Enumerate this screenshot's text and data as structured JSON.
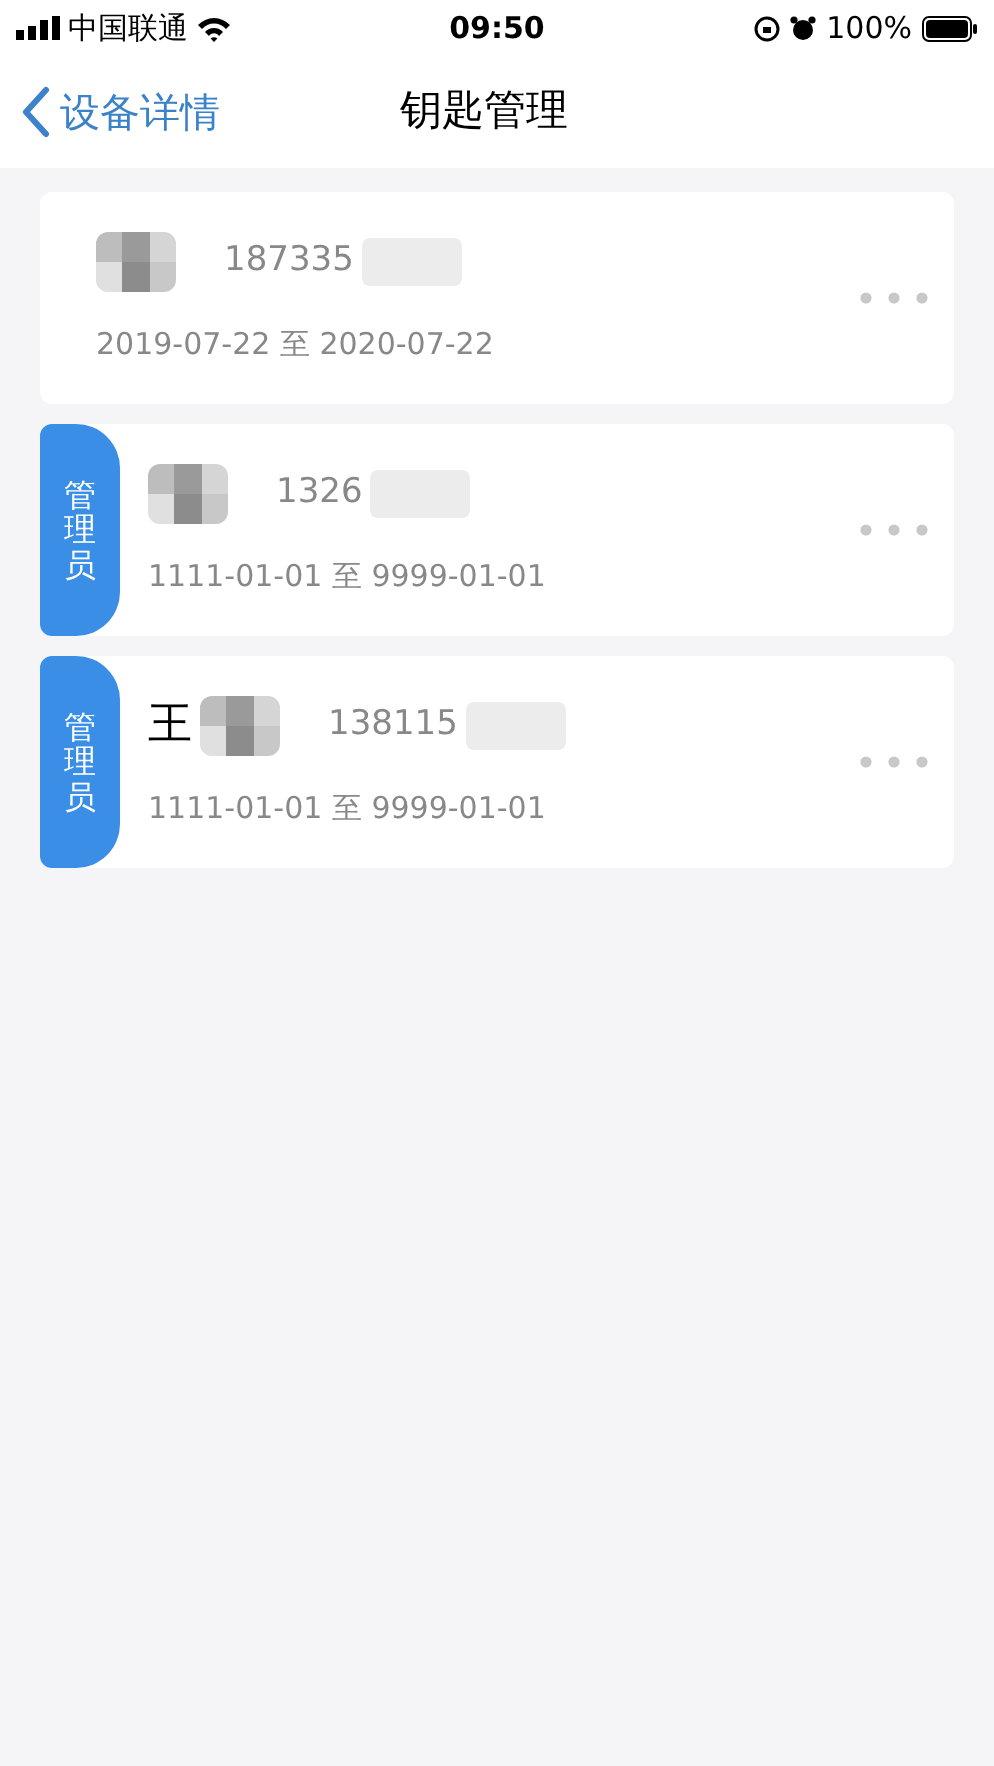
{
  "status_bar": {
    "carrier": "中国联通",
    "time": "09:50",
    "battery": "100%"
  },
  "nav": {
    "back": "设备详情",
    "title": "钥匙管理"
  },
  "keys": [
    {
      "phone": "187335",
      "period": "2019-07-22 至 2020-07-22"
    },
    {
      "badge": "管理员",
      "phone": "1326",
      "period": "1111-01-01 至 9999-01-01"
    },
    {
      "badge": "管理员",
      "name": "王",
      "phone": "138115",
      "period": "1111-01-01 至 9999-01-01"
    }
  ]
}
